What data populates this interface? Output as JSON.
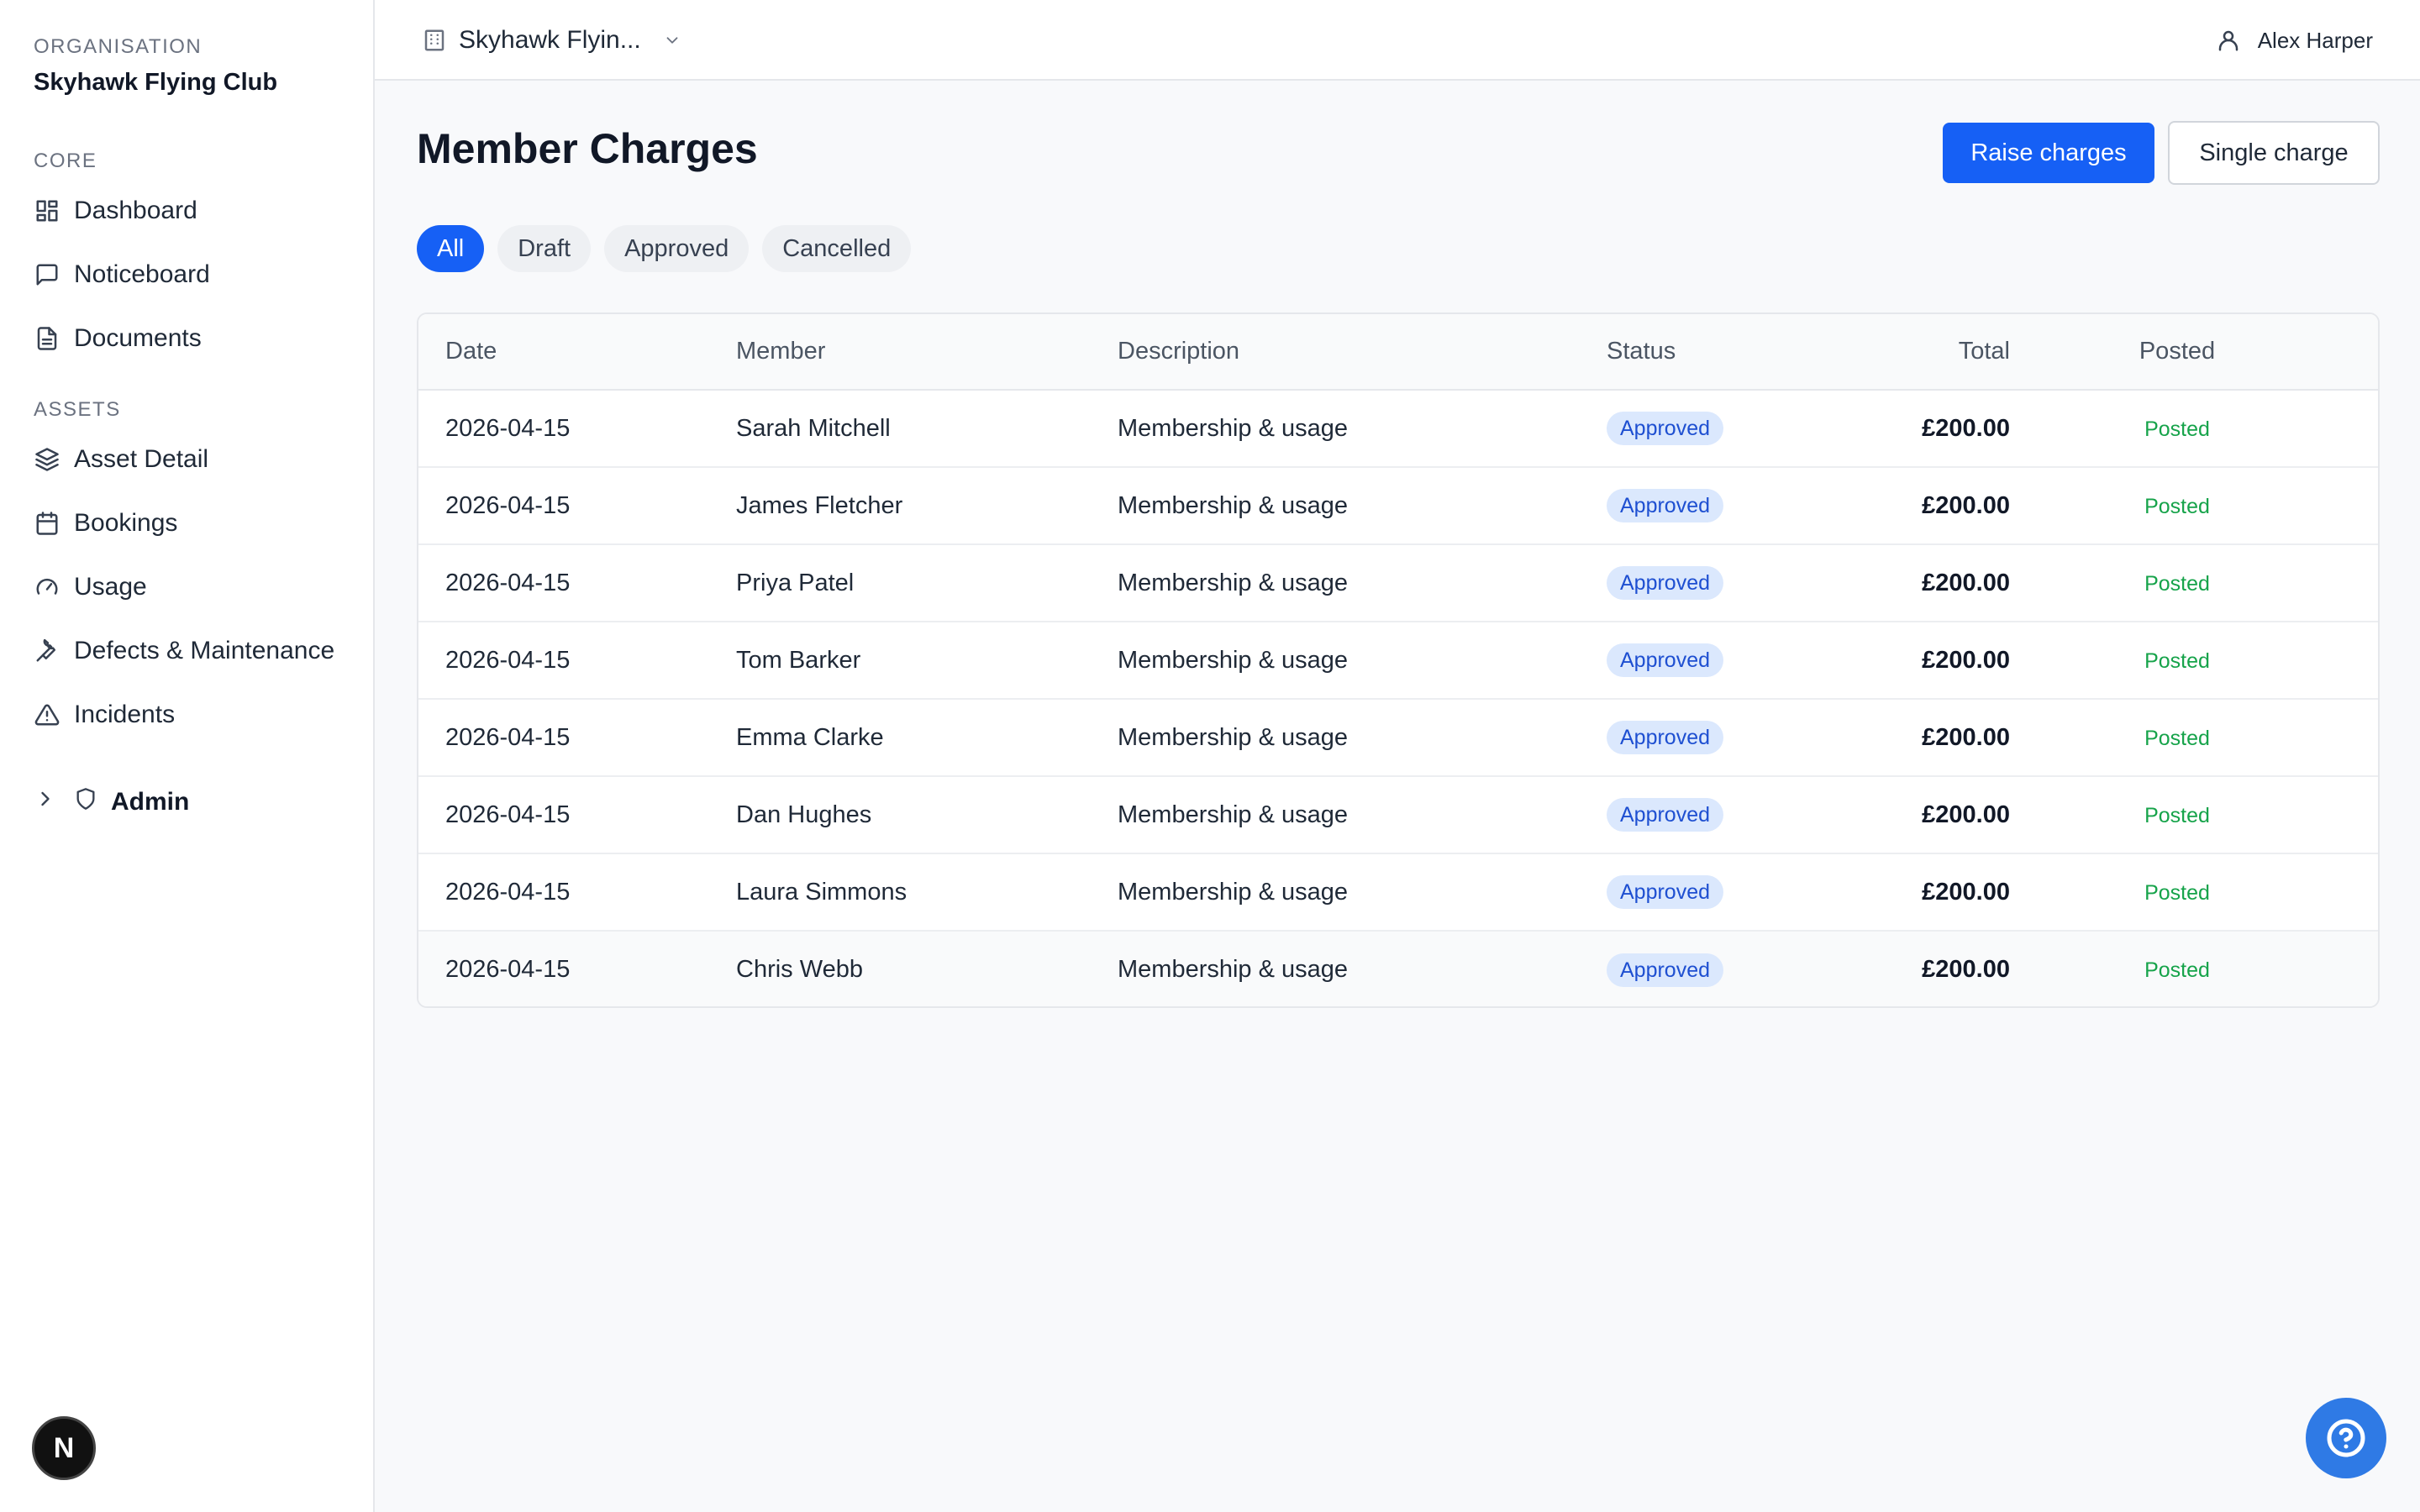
{
  "sidebar": {
    "org_label": "ORGANISATION",
    "org_name": "Skyhawk Flying Club",
    "core_label": "CORE",
    "core_items": [
      {
        "label": "Dashboard",
        "icon": "dashboard-icon"
      },
      {
        "label": "Noticeboard",
        "icon": "message-icon"
      },
      {
        "label": "Documents",
        "icon": "document-icon"
      }
    ],
    "assets_label": "ASSETS",
    "assets_items": [
      {
        "label": "Asset Detail",
        "icon": "layers-icon"
      },
      {
        "label": "Bookings",
        "icon": "calendar-icon"
      },
      {
        "label": "Usage",
        "icon": "gauge-icon"
      },
      {
        "label": "Defects & Maintenance",
        "icon": "wrench-icon"
      },
      {
        "label": "Incidents",
        "icon": "warning-icon"
      }
    ],
    "admin_label": "Admin",
    "badge_letter": "N"
  },
  "topbar": {
    "org_switcher": "Skyhawk Flyin...",
    "user_name": "Alex Harper"
  },
  "page": {
    "title": "Member Charges",
    "raise_button": "Raise charges",
    "single_button": "Single charge"
  },
  "filters": [
    "All",
    "Draft",
    "Approved",
    "Cancelled"
  ],
  "table": {
    "headers": {
      "date": "Date",
      "member": "Member",
      "description": "Description",
      "status": "Status",
      "total": "Total",
      "posted": "Posted"
    },
    "rows": [
      {
        "date": "2026-04-15",
        "member": "Sarah Mitchell",
        "description": "Membership & usage",
        "status": "Approved",
        "total": "£200.00",
        "posted": "Posted"
      },
      {
        "date": "2026-04-15",
        "member": "James Fletcher",
        "description": "Membership & usage",
        "status": "Approved",
        "total": "£200.00",
        "posted": "Posted"
      },
      {
        "date": "2026-04-15",
        "member": "Priya Patel",
        "description": "Membership & usage",
        "status": "Approved",
        "total": "£200.00",
        "posted": "Posted"
      },
      {
        "date": "2026-04-15",
        "member": "Tom Barker",
        "description": "Membership & usage",
        "status": "Approved",
        "total": "£200.00",
        "posted": "Posted"
      },
      {
        "date": "2026-04-15",
        "member": "Emma Clarke",
        "description": "Membership & usage",
        "status": "Approved",
        "total": "£200.00",
        "posted": "Posted"
      },
      {
        "date": "2026-04-15",
        "member": "Dan Hughes",
        "description": "Membership & usage",
        "status": "Approved",
        "total": "£200.00",
        "posted": "Posted"
      },
      {
        "date": "2026-04-15",
        "member": "Laura Simmons",
        "description": "Membership & usage",
        "status": "Approved",
        "total": "£200.00",
        "posted": "Posted"
      },
      {
        "date": "2026-04-15",
        "member": "Chris Webb",
        "description": "Membership & usage",
        "status": "Approved",
        "total": "£200.00",
        "posted": "Posted"
      }
    ]
  },
  "colors": {
    "primary": "#1660f5",
    "status_badge_bg": "#dbe8fd",
    "status_badge_text": "#1e4fd1",
    "posted_text": "#16a34a"
  }
}
